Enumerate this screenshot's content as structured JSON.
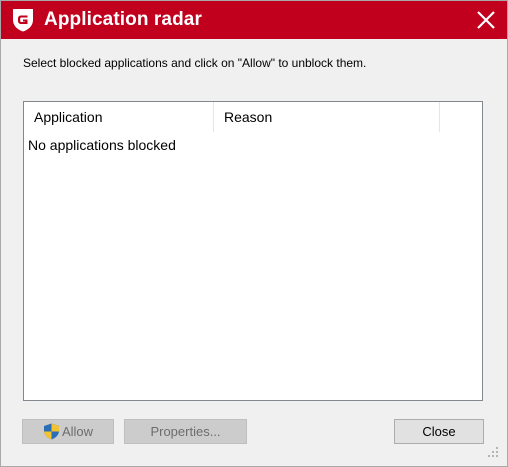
{
  "window": {
    "title": "Application radar",
    "instruction": "Select blocked applications and click on \"Allow\" to unblock them.",
    "accent_color": "#c0001c"
  },
  "list": {
    "columns": [
      "Application",
      "Reason",
      ""
    ],
    "empty_message": "No applications blocked"
  },
  "buttons": {
    "allow_label": "Allow",
    "properties_label": "Properties...",
    "close_label": "Close"
  },
  "icons": {
    "title_logo": "gdata-logo-icon",
    "close": "close-icon",
    "allow": "uac-shield-icon",
    "resize": "resize-grip-icon"
  }
}
